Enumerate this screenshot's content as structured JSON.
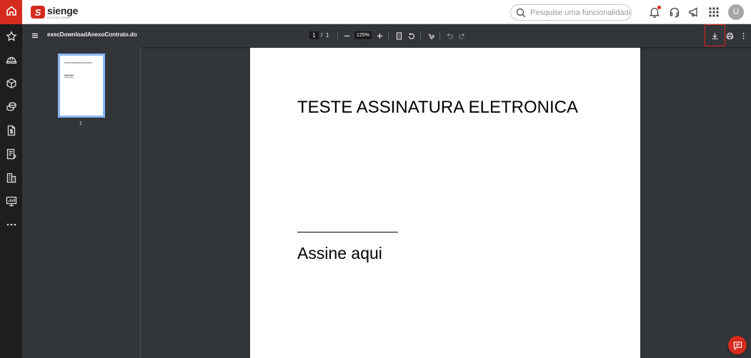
{
  "app": {
    "logo_name": "sienge",
    "logo_sub": "PLATAFORMA"
  },
  "header": {
    "search_placeholder": "Pesquise uma funcionalidade.",
    "avatar_initial": "U",
    "notification_badge_color": "#d52b1e"
  },
  "sidebar": {
    "items": [
      {
        "icon": "home-icon",
        "active": true
      },
      {
        "icon": "star-icon"
      },
      {
        "icon": "helmet-icon"
      },
      {
        "icon": "box-icon"
      },
      {
        "icon": "coins-icon"
      },
      {
        "icon": "document-money-icon"
      },
      {
        "icon": "report-icon"
      },
      {
        "icon": "building-icon"
      },
      {
        "icon": "monitor-chart-icon"
      },
      {
        "icon": "more-icon"
      }
    ],
    "accent_color": "#d52b1e"
  },
  "pdf_viewer": {
    "file_name": "execDownloadAnexoContrato.do",
    "current_page": "1",
    "page_separator": "/",
    "total_pages": "1",
    "zoom": "125%",
    "thumbnail_label": "1"
  },
  "document": {
    "title": "TESTE ASSINATURA ELETRONICA",
    "signature_label": "Assine aqui"
  },
  "colors": {
    "brand": "#d52b1e",
    "viewer_bg": "#323639",
    "highlight": "#e02020"
  }
}
